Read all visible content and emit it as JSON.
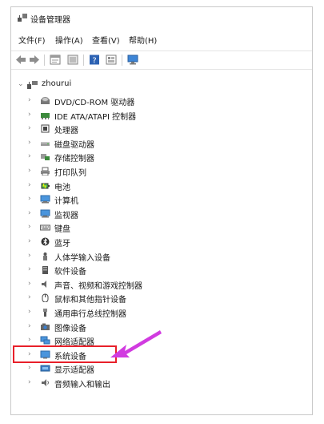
{
  "window": {
    "title": "设备管理器"
  },
  "menu": [
    "文件(F)",
    "操作(A)",
    "查看(V)",
    "帮助(H)"
  ],
  "toolbar": {
    "buttons": [
      "back-icon",
      "forward-icon",
      "properties-icon",
      "update-icon",
      "help-icon",
      "view-icon",
      "monitor-icon"
    ]
  },
  "tree": {
    "root": "zhourui",
    "items": [
      {
        "label": "DVD/CD-ROM 驱动器",
        "icon": "dvd-icon"
      },
      {
        "label": "IDE ATA/ATAPI 控制器",
        "icon": "ide-controller-icon"
      },
      {
        "label": "处理器",
        "icon": "processor-icon"
      },
      {
        "label": "磁盘驱动器",
        "icon": "disk-drive-icon"
      },
      {
        "label": "存储控制器",
        "icon": "storage-controller-icon"
      },
      {
        "label": "打印队列",
        "icon": "printer-icon"
      },
      {
        "label": "电池",
        "icon": "battery-icon"
      },
      {
        "label": "计算机",
        "icon": "computer-icon"
      },
      {
        "label": "监视器",
        "icon": "monitor-icon"
      },
      {
        "label": "键盘",
        "icon": "keyboard-icon"
      },
      {
        "label": "蓝牙",
        "icon": "bluetooth-icon"
      },
      {
        "label": "人体学输入设备",
        "icon": "hid-icon"
      },
      {
        "label": "软件设备",
        "icon": "software-device-icon"
      },
      {
        "label": "声音、视频和游戏控制器",
        "icon": "sound-icon"
      },
      {
        "label": "鼠标和其他指针设备",
        "icon": "mouse-icon"
      },
      {
        "label": "通用串行总线控制器",
        "icon": "usb-icon"
      },
      {
        "label": "图像设备",
        "icon": "camera-icon"
      },
      {
        "label": "网络适配器",
        "icon": "network-icon"
      },
      {
        "label": "系统设备",
        "icon": "system-device-icon"
      },
      {
        "label": "显示适配器",
        "icon": "display-adapter-icon"
      },
      {
        "label": "音频输入和输出",
        "icon": "audio-io-icon"
      }
    ]
  },
  "colors": {
    "highlight_box": "#e8202a",
    "arrow": "#d13be0",
    "chevron": "#7a7a7a"
  }
}
